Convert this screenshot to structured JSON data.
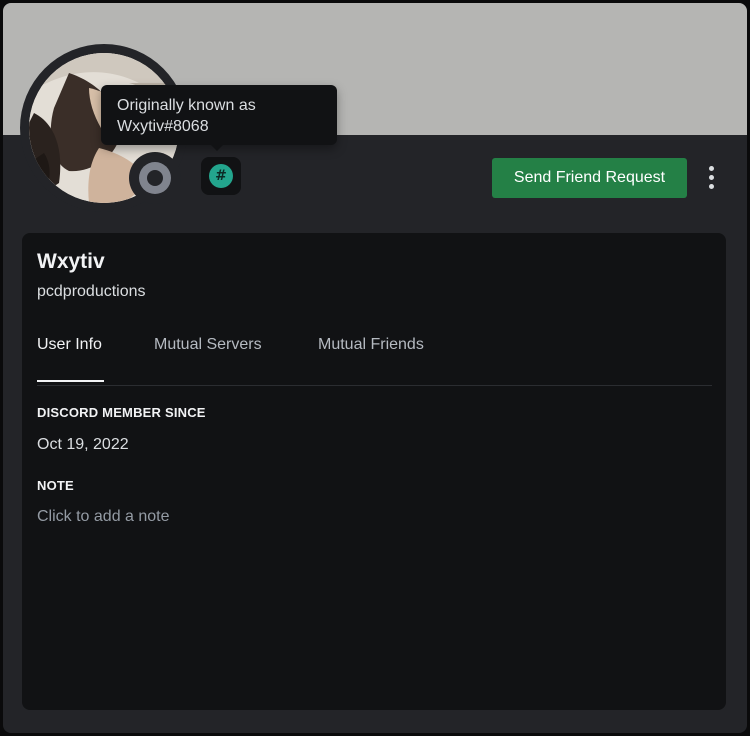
{
  "profile": {
    "display_name": "Wxytiv",
    "username": "pcdproductions",
    "status": "offline",
    "banner_color": "#b5b5b3"
  },
  "badge": {
    "icon": "hashtag-icon",
    "glyph": "#",
    "color": "#23a58d"
  },
  "tooltip": {
    "line1": "Originally known as",
    "line2": "Wxytiv#8068"
  },
  "actions": {
    "send_friend_request_label": "Send Friend Request",
    "button_color": "#248046",
    "more_icon": "more-vertical-icon"
  },
  "tabs": [
    {
      "label": "User Info",
      "active": true
    },
    {
      "label": "Mutual Servers",
      "active": false
    },
    {
      "label": "Mutual Friends",
      "active": false
    }
  ],
  "user_info": {
    "member_since_header": "Discord Member Since",
    "member_since_value": "Oct 19, 2022",
    "note_header": "Note",
    "note_placeholder": "Click to add a note",
    "note_value": ""
  }
}
